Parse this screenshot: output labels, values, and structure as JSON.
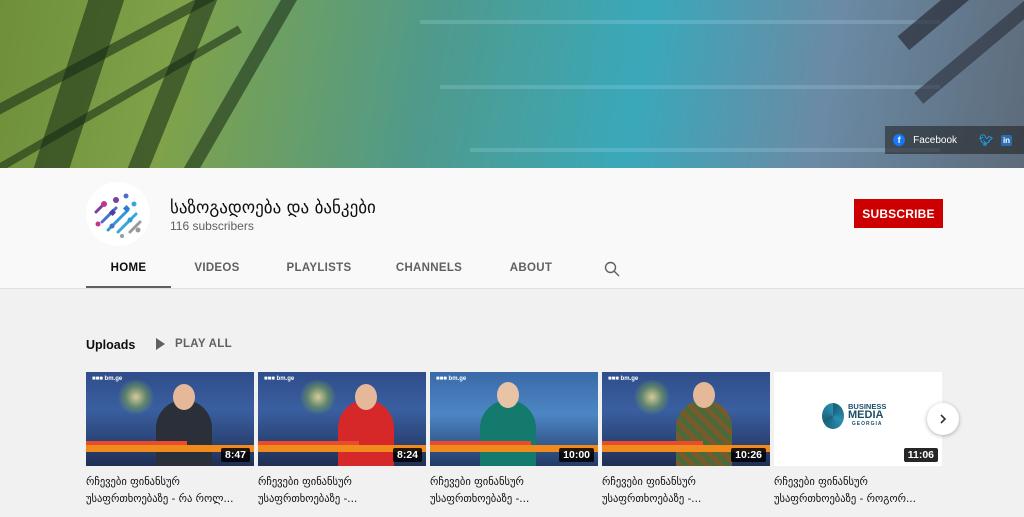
{
  "banner": {
    "social": [
      {
        "label": "Facebook",
        "icon": "facebook-icon"
      },
      {
        "label": "",
        "icon": "twitter-icon"
      },
      {
        "label": "",
        "icon": "linkedin-icon"
      }
    ]
  },
  "channel": {
    "name": "საზოგადოება და ბანკები",
    "subscribers": "116 subscribers",
    "subscribe_label": "SUBSCRIBE",
    "subscribe_color": "#cc0000"
  },
  "tabs": [
    {
      "label": "HOME",
      "active": true
    },
    {
      "label": "VIDEOS",
      "active": false
    },
    {
      "label": "PLAYLISTS",
      "active": false
    },
    {
      "label": "CHANNELS",
      "active": false
    },
    {
      "label": "ABOUT",
      "active": false
    }
  ],
  "uploads": {
    "title": "Uploads",
    "play_all": "PLAY ALL",
    "videos": [
      {
        "duration": "8:47",
        "title_line1": "რჩევები ფინანსურ",
        "title_line2": "უსაფრთხოებაზე - რა როლ..."
      },
      {
        "duration": "8:24",
        "title_line1": "რჩევები ფინანსურ",
        "title_line2": "უსაფრთხოებაზე -..."
      },
      {
        "duration": "10:00",
        "title_line1": "რჩევები ფინანსურ",
        "title_line2": "უსაფრთხოებაზე -..."
      },
      {
        "duration": "10:26",
        "title_line1": "რჩევები ფინანსურ",
        "title_line2": "უსაფრთხოებაზე -..."
      },
      {
        "duration": "11:06",
        "title_line1": "რჩევები ფინანსურ",
        "title_line2": "უსაფრთხოებაზე - როგორ...",
        "thumb_text": {
          "line1": "BUSINESS",
          "line2": "MEDIA",
          "line3": "GEORGIA"
        }
      }
    ]
  }
}
